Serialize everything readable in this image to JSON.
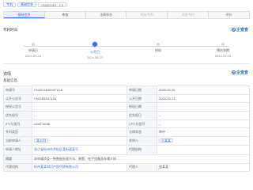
{
  "breadcrumb": {
    "items": [
      "专利",
      "基础信息"
    ],
    "code": "CN202410...1.5"
  },
  "tabs": [
    {
      "label": "基础信息",
      "state": "active"
    },
    {
      "label": "审查",
      "state": "normal"
    },
    {
      "label": "法律状态",
      "state": "normal"
    },
    {
      "label": "相似专利",
      "state": "dim"
    },
    {
      "label": "同族专利",
      "state": "dim"
    },
    {
      "label": "评价",
      "state": "normal"
    }
  ],
  "timeline_section": {
    "title": "专利时间",
    "action_label": "企查查"
  },
  "timeline": [
    {
      "label": "申请日",
      "date": "2024-05-16",
      "active": false
    },
    {
      "label": "公开日",
      "date": "2024-08-13",
      "active": true
    },
    {
      "label": "授权",
      "date": "",
      "active": false
    },
    {
      "label": "预估到期",
      "date": "2044-05-16",
      "active": false
    }
  ],
  "detail_section": {
    "title": "详情",
    "action_label": "企查查",
    "subtitle": "基础信息"
  },
  "rows": [
    {
      "l1": "申请号",
      "v1": "CN202410604713.8",
      "l2": "申请日期",
      "v2": "2025-05-26"
    },
    {
      "l1": "公开公告号",
      "v1": "CN118534713A",
      "l2": "公开日期",
      "v2": "2025-09-13"
    },
    {
      "l1": "授权公告号",
      "v1": "",
      "l2": "授权日期",
      "v2": ""
    },
    {
      "l1": "优先权号",
      "v1": "--",
      "l2": "优先权日",
      "v2": "--"
    },
    {
      "l1": "IPC分类号",
      "v1": "G06F16/36",
      "l2": "CPC分类号",
      "v2": "--"
    },
    {
      "l1": "专利类型",
      "v1": "",
      "l2": "法律状态",
      "v2": "审中"
    },
    {
      "l1": "当前申请人",
      "v1": "某公司",
      "l2": "发明人",
      "v2": "王某某"
    },
    {
      "l1": "申请人地址",
      "v1": "浙江省杭州市余杭区某街道某号 ...",
      "l2": "代理机构",
      "v2": ""
    },
    {
      "l1": "代理人",
      "v1": "",
      "l2": "代理机构",
      "v2": ""
    }
  ],
  "span_rows": [
    {
      "label": "摘要",
      "value": "本申请涉及一种数据处理方法、装置、电子设备及存储介质……"
    }
  ],
  "last_row": {
    "l1": "代理机构",
    "v1": "杭州某某知识产权代理有限公司",
    "l2": "代理人",
    "v2": "张某某"
  }
}
